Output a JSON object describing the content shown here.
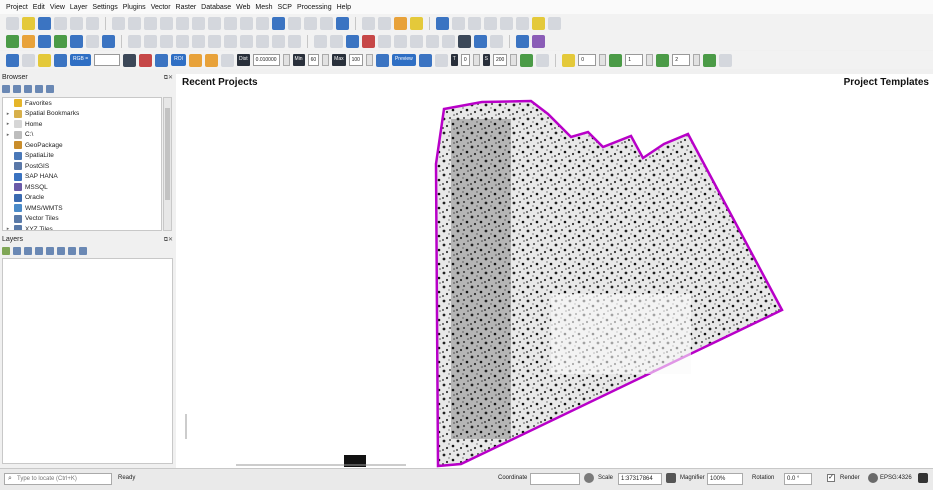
{
  "menu": [
    "Project",
    "Edit",
    "View",
    "Layer",
    "Settings",
    "Plugins",
    "Vector",
    "Raster",
    "Database",
    "Web",
    "Mesh",
    "SCP",
    "Processing",
    "Help"
  ],
  "scp_toolbar": {
    "band_set": "RGB =",
    "roi_label": "ROI",
    "dist_label": "Dist",
    "dist_value": "0.010000",
    "min_label": "Min",
    "min_value": "60",
    "max_label": "Max",
    "max_value": "100",
    "preview_label": "Preview",
    "t_label": "T",
    "t_value": "0",
    "s_label": "S",
    "s_value": "200",
    "field_a": "0",
    "field_b": "1",
    "field_c": "2"
  },
  "browser": {
    "title": "Browser",
    "items": [
      {
        "label": "Favorites",
        "icon": "star-icon",
        "color": "#e5b52a",
        "arrow": ""
      },
      {
        "label": "Spatial Bookmarks",
        "icon": "bookmark-icon",
        "color": "#d7b04b",
        "arrow": "▸"
      },
      {
        "label": "Home",
        "icon": "home-folder-icon",
        "color": "#d6d6d6",
        "arrow": "▸"
      },
      {
        "label": "C:\\",
        "icon": "drive-icon",
        "color": "#bdbdbd",
        "arrow": "▸"
      },
      {
        "label": "GeoPackage",
        "icon": "geopackage-icon",
        "color": "#c98d2b",
        "arrow": ""
      },
      {
        "label": "SpatiaLite",
        "icon": "spatialite-icon",
        "color": "#4a78b8",
        "arrow": ""
      },
      {
        "label": "PostGIS",
        "icon": "postgis-icon",
        "color": "#5a78a8",
        "arrow": ""
      },
      {
        "label": "SAP HANA",
        "icon": "sap-hana-icon",
        "color": "#3a72c0",
        "arrow": ""
      },
      {
        "label": "MSSQL",
        "icon": "mssql-icon",
        "color": "#6a5aa8",
        "arrow": ""
      },
      {
        "label": "Oracle",
        "icon": "oracle-icon",
        "color": "#3a6ab0",
        "arrow": ""
      },
      {
        "label": "WMS/WMTS",
        "icon": "globe-icon",
        "color": "#4a8ac8",
        "arrow": ""
      },
      {
        "label": "Vector Tiles",
        "icon": "vector-tiles-icon",
        "color": "#5a7aa8",
        "arrow": ""
      },
      {
        "label": "XYZ Tiles",
        "icon": "xyz-tiles-icon",
        "color": "#5a7aa8",
        "arrow": "▸"
      }
    ]
  },
  "layers": {
    "title": "Layers"
  },
  "canvas": {
    "recent_projects": "Recent Projects",
    "project_templates": "Project Templates"
  },
  "statusbar": {
    "locator_placeholder": "Type to locate (Ctrl+K)",
    "status": "Ready",
    "coordinate_label": "Coordinate",
    "coordinate_value": "",
    "scale_label": "Scale",
    "scale_value": "1:37317864",
    "magnifier_label": "Magnifier",
    "magnifier_value": "100%",
    "rotation_label": "Rotation",
    "rotation_value": "0.0 °",
    "render_label": "Render",
    "crs": "EPSG:4326"
  },
  "colors": {
    "boundary": "#b800c8",
    "scp_blue": "#2f6fc4",
    "panel_bg": "#f0f0f0"
  }
}
